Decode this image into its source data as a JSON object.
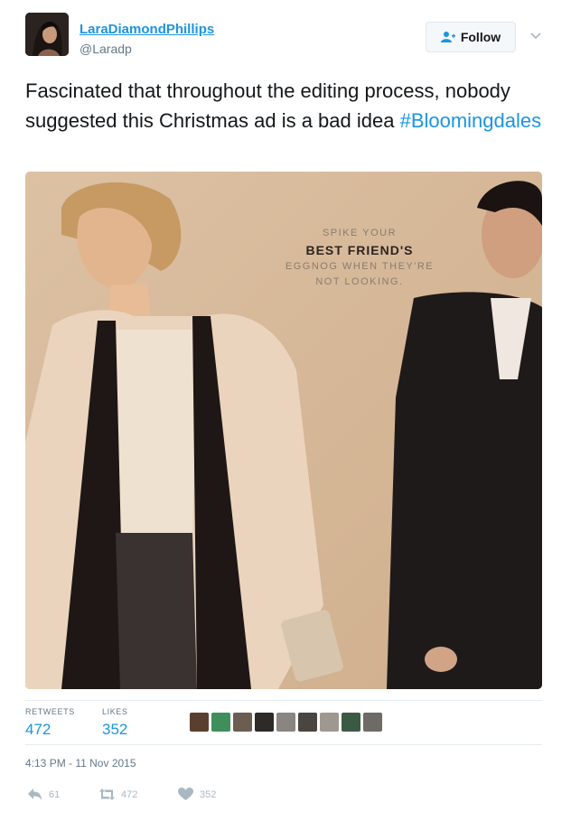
{
  "user": {
    "display_name": "LaraDiamondPhillips",
    "handle": "@Laradp",
    "follow_label": "Follow"
  },
  "tweet": {
    "text": "Fascinated that throughout the editing process, nobody suggested this Christmas ad is a bad idea",
    "hashtag": "#Bloomingdales"
  },
  "ad": {
    "line1": "SPIKE YOUR",
    "line2": "BEST FRIEND'S",
    "line3": "EGGNOG WHEN THEY'RE",
    "line4": "NOT LOOKING."
  },
  "stats": {
    "retweets_label": "RETWEETS",
    "retweets_value": "472",
    "likes_label": "LIKES",
    "likes_value": "352"
  },
  "likers": [
    {
      "icon": "avatar",
      "color": "#5a3f2e"
    },
    {
      "icon": "avatar",
      "color": "#3f8f5a"
    },
    {
      "icon": "avatar",
      "color": "#6b5d4f"
    },
    {
      "icon": "avatar",
      "color": "#2d2a28"
    },
    {
      "icon": "avatar",
      "color": "#8a8580"
    },
    {
      "icon": "avatar",
      "color": "#4a4540"
    },
    {
      "icon": "avatar",
      "color": "#9e9890"
    },
    {
      "icon": "avatar",
      "color": "#3b5a44"
    },
    {
      "icon": "avatar",
      "color": "#6e6a66"
    }
  ],
  "timestamp": "4:13 PM - 11 Nov 2015",
  "actions": {
    "reply_count": "61",
    "retweet_count": "472",
    "like_count": "352"
  },
  "colors": {
    "link": "#1b95e0",
    "secondary_text": "#657786",
    "action_gray": "#aab8c2",
    "divider": "#e6ecf0"
  }
}
